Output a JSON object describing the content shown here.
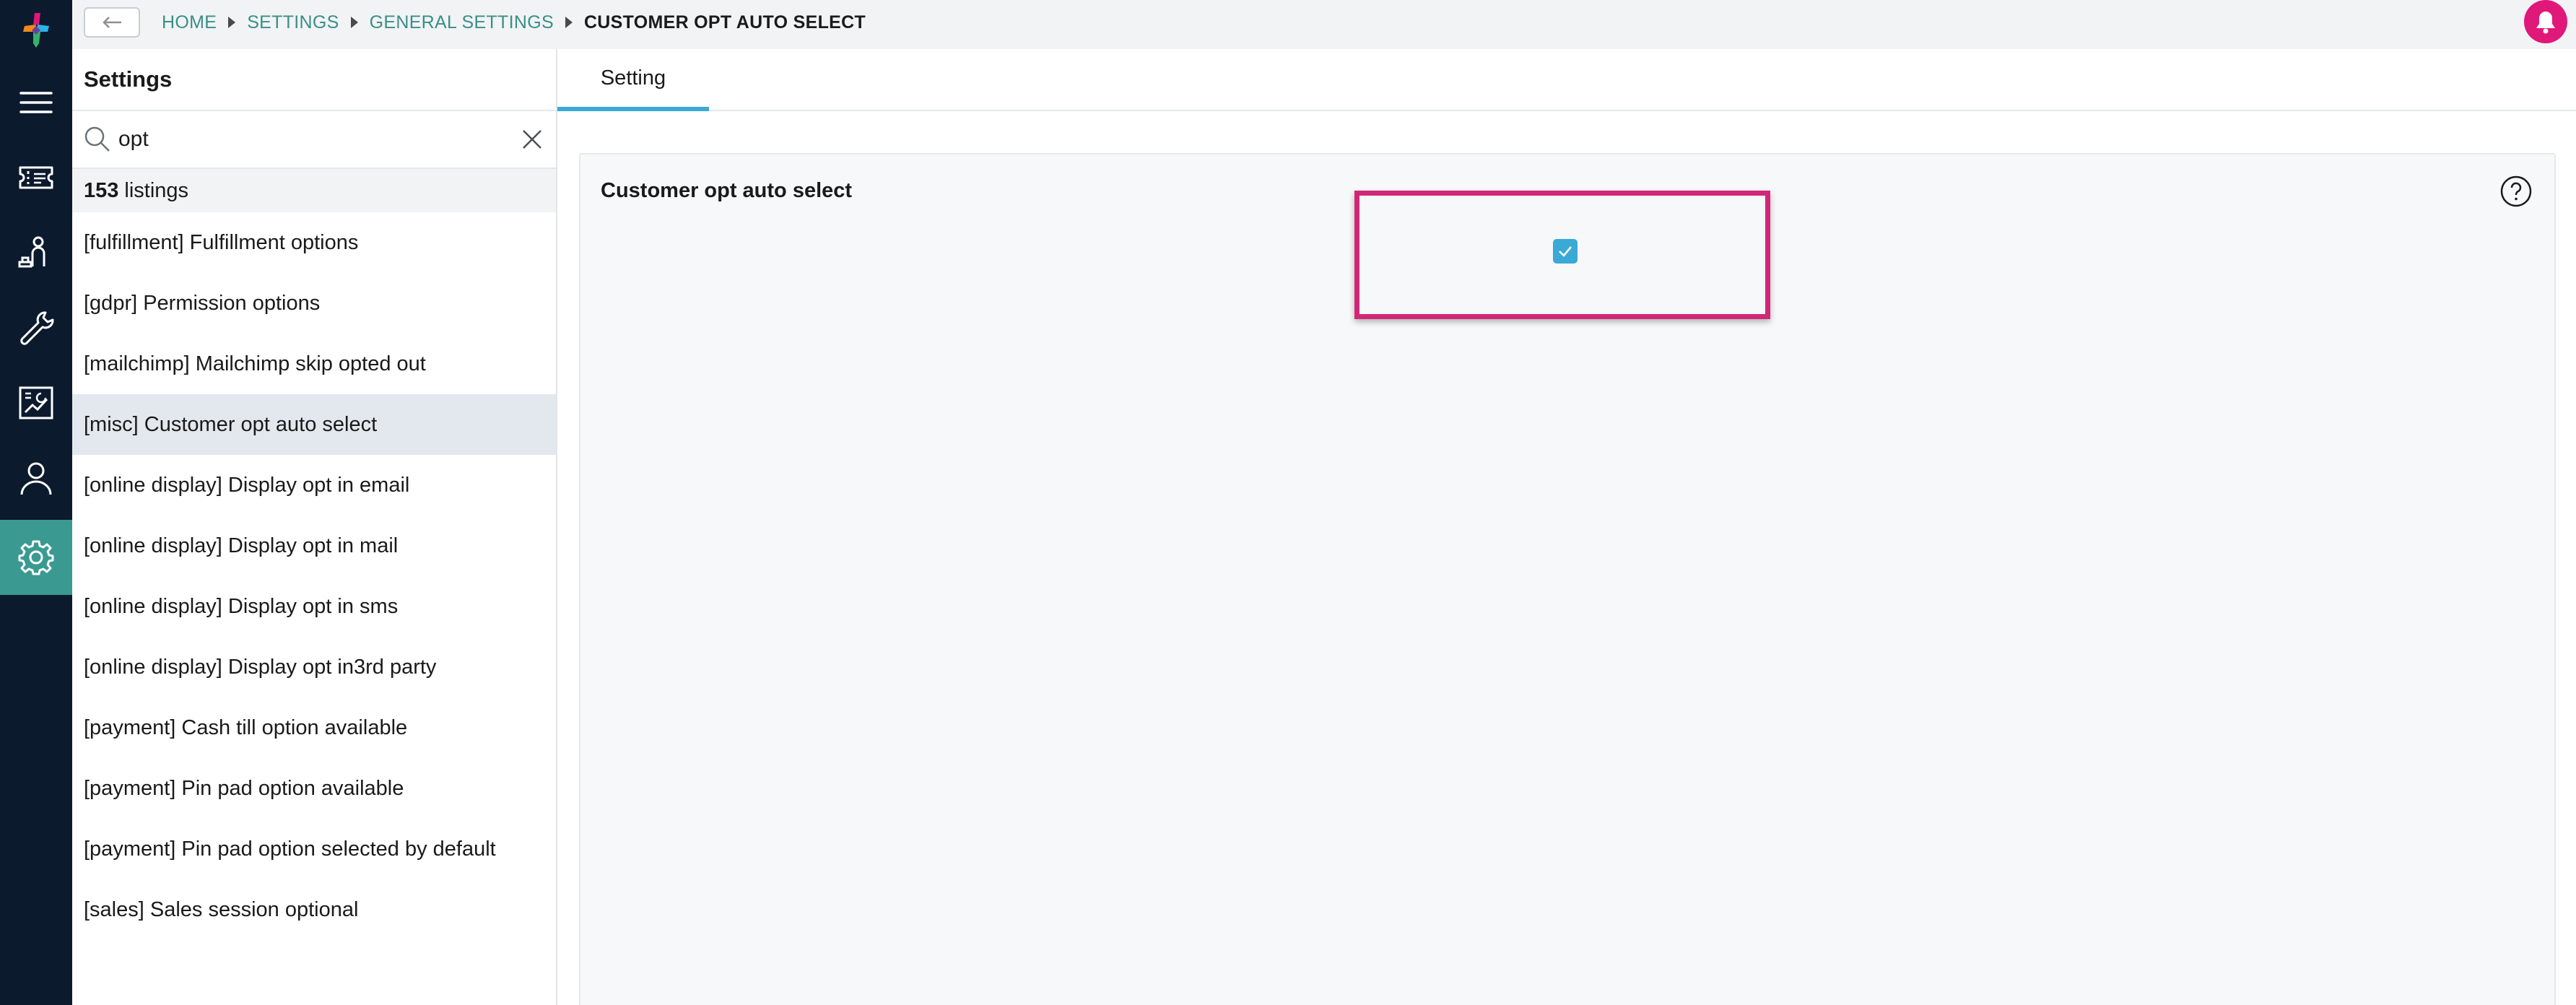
{
  "rail": {
    "items": [
      "logo",
      "menu-icon",
      "ticket-icon",
      "customer-service-icon",
      "wrench-icon",
      "report-icon",
      "user-icon",
      "gear-icon"
    ],
    "active": "gear-icon",
    "active_color": "#3a9a92",
    "background": "#0c1a2e"
  },
  "topbar": {
    "breadcrumb": [
      "HOME",
      "SETTINGS",
      "GENERAL SETTINGS",
      "CUSTOMER OPT AUTO SELECT"
    ],
    "notification_color": "#e0187a"
  },
  "sidebar": {
    "title": "Settings",
    "search": {
      "value": "opt",
      "placeholder": ""
    },
    "count": "153",
    "count_label": "listings",
    "items": [
      {
        "label": "[fulfillment] Fulfillment options"
      },
      {
        "label": "[gdpr] Permission options"
      },
      {
        "label": "[mailchimp] Mailchimp skip opted out"
      },
      {
        "label": "[misc] Customer opt auto select",
        "selected": true
      },
      {
        "label": "[online display] Display opt in email"
      },
      {
        "label": "[online display] Display opt in mail"
      },
      {
        "label": "[online display] Display opt in sms"
      },
      {
        "label": "[online display] Display opt in3rd party"
      },
      {
        "label": "[payment] Cash till option available"
      },
      {
        "label": "[payment] Pin pad option available"
      },
      {
        "label": "[payment] Pin pad option selected by default"
      },
      {
        "label": "[sales] Sales session optional"
      }
    ]
  },
  "main": {
    "tabs": [
      {
        "label": "Setting",
        "active": true
      }
    ],
    "setting": {
      "label": "Customer opt auto select",
      "checked": true,
      "checkbox_color": "#3aa9d6",
      "highlight_color": "#d12779"
    }
  }
}
